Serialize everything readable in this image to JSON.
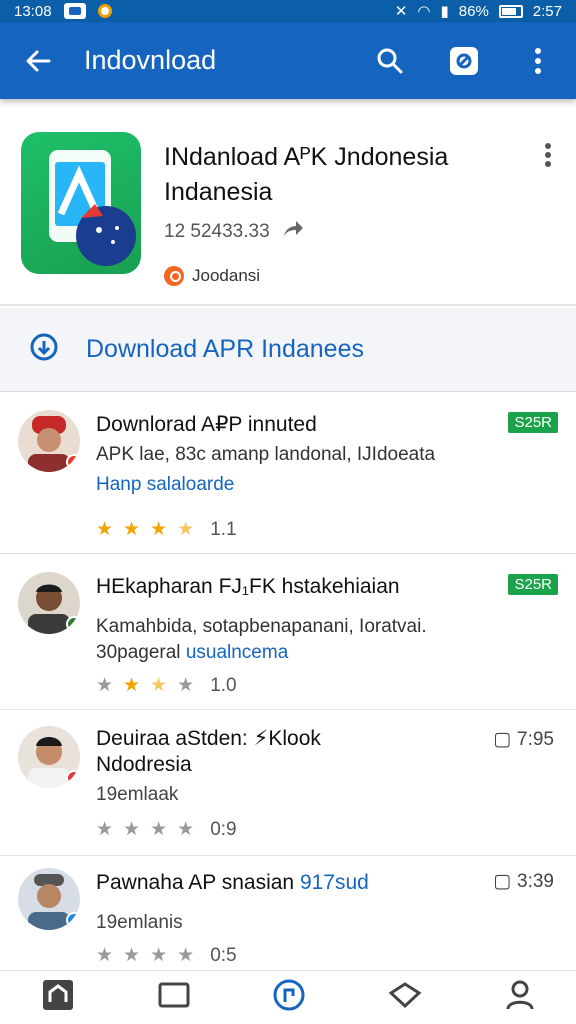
{
  "status": {
    "time": "13:08",
    "battery": "86%",
    "clock_right": "2:57"
  },
  "appbar": {
    "title": "Indovnload"
  },
  "app": {
    "name_line1": "INdanload AᴾK Jndonesia",
    "name_line2": "Indanesia",
    "meta": "12 52433.33",
    "developer": "Joodansi"
  },
  "download": {
    "label": "Download APR  Indanees"
  },
  "reviews": [
    {
      "title": "Downlorad A₽P  innuted",
      "text": "APK lae, 83c  amanp landonal, IJIdoeata",
      "link": "Hanp salaloarde",
      "stars": [
        true,
        true,
        true,
        true
      ],
      "count": "1.1",
      "tag": "S25R",
      "avatar_color": "#c62828"
    },
    {
      "title": "HEkapharan FJ₁FK hstakehiaian",
      "text": "Kamahbida, sotapbenapanani, Ioratvai.",
      "text2": "30pageral",
      "link": "usualncema",
      "stars": [
        true,
        true,
        true,
        true
      ],
      "count": "1.0",
      "tag": "S25R",
      "avatar_color": "#2e7d32"
    },
    {
      "title": "Deuiraa aStden: ⚡Klook",
      "title2": "Ndodresia",
      "text": "19emlaak",
      "stars": [
        true,
        true,
        true,
        true
      ],
      "count": "0:9",
      "time": "7:95",
      "avatar_color": "#e53935"
    },
    {
      "title": "Pawnaha AP snasian",
      "title_link": "917sud",
      "text": "19emlanis",
      "stars": [
        true,
        true,
        true,
        true
      ],
      "count": "0:5",
      "time": "3:39",
      "avatar_color": "#1e88e5"
    }
  ],
  "colors": {
    "primary": "#1565c0",
    "accent_green": "#1aa34a",
    "star": "#f0a500"
  },
  "nav": [
    "home-icon",
    "tablet-icon",
    "apps-icon",
    "diamond-icon",
    "profile-icon"
  ]
}
